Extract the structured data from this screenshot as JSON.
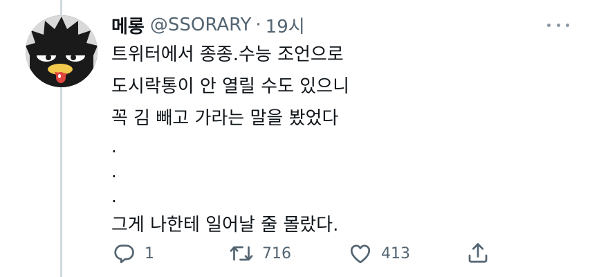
{
  "tweet": {
    "display_name": "메롱",
    "handle": "@SSORARY",
    "separator": "·",
    "time": "19시",
    "lines": [
      "트위터에서 종종.수능 조언으로",
      "도시락통이 안 열릴 수도 있으니",
      "꼭 김 빼고 가라는 말을 봤었다"
    ],
    "dots": [
      ".",
      ".",
      "."
    ],
    "closing": "그게 나한테 일어날 줄 몰랐다."
  },
  "actions": {
    "reply_count": "1",
    "retweet_count": "716",
    "like_count": "413",
    "reply_icon": "reply-icon",
    "retweet_icon": "retweet-icon",
    "like_icon": "heart-icon",
    "share_icon": "share-icon"
  },
  "colors": {
    "text": "#0f1419",
    "secondary": "#536471",
    "thread_line": "#cfd9de"
  }
}
